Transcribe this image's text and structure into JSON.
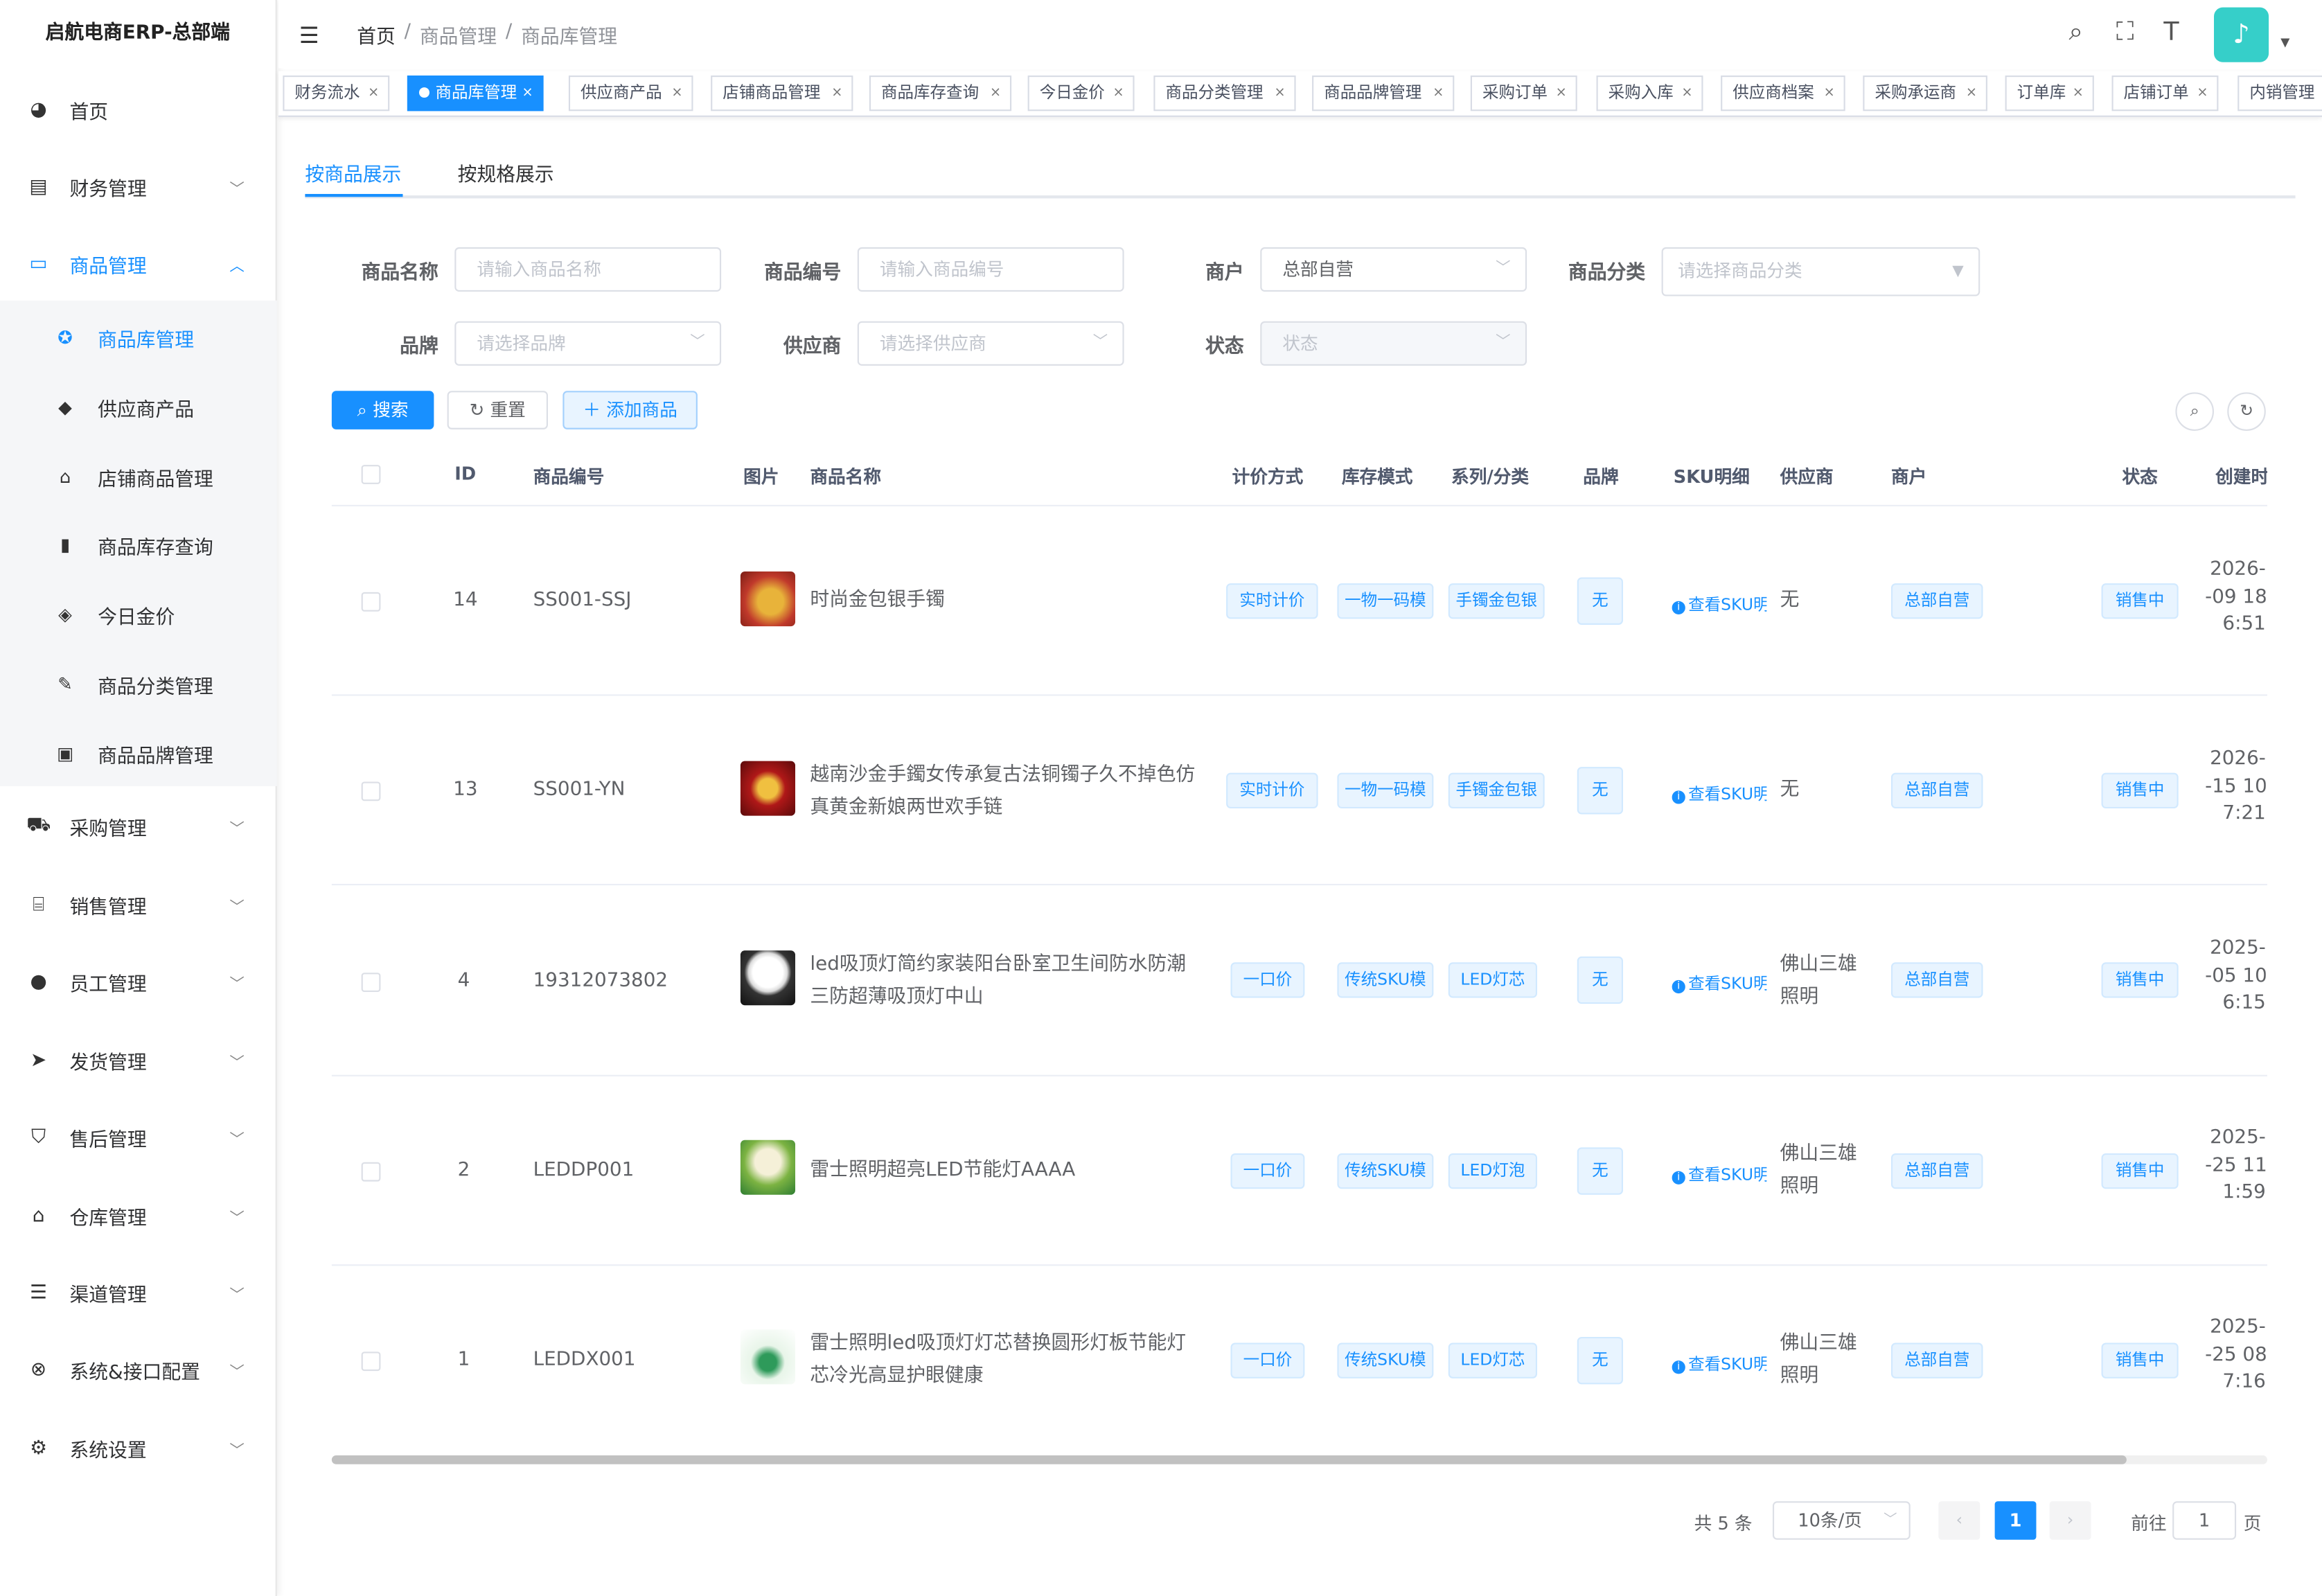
{
  "app_title": "启航电商ERP-总部端",
  "sidebar": {
    "items": [
      {
        "label": "首页",
        "icon": "dashboard-icon"
      },
      {
        "label": "财务管理",
        "icon": "finance-icon"
      },
      {
        "label": "商品管理",
        "icon": "bag-icon"
      },
      {
        "label": "采购管理",
        "icon": "cart-icon"
      },
      {
        "label": "销售管理",
        "icon": "sales-icon"
      },
      {
        "label": "员工管理",
        "icon": "user-icon"
      },
      {
        "label": "发货管理",
        "icon": "send-icon"
      },
      {
        "label": "售后管理",
        "icon": "shield-icon"
      },
      {
        "label": "仓库管理",
        "icon": "warehouse-icon"
      },
      {
        "label": "渠道管理",
        "icon": "channel-icon"
      },
      {
        "label": "系统&接口配置",
        "icon": "api-icon"
      },
      {
        "label": "系统设置",
        "icon": "gear-icon"
      }
    ],
    "sub_items": [
      {
        "label": "商品库管理",
        "icon": "compass-icon"
      },
      {
        "label": "供应商产品",
        "icon": "cube-icon"
      },
      {
        "label": "店铺商品管理",
        "icon": "shop-icon"
      },
      {
        "label": "商品库存查询",
        "icon": "chart-icon"
      },
      {
        "label": "今日金价",
        "icon": "gold-icon"
      },
      {
        "label": "商品分类管理",
        "icon": "edit-icon"
      },
      {
        "label": "商品品牌管理",
        "icon": "brand-icon"
      }
    ]
  },
  "header": {
    "breadcrumb": [
      "首页",
      "商品管理",
      "商品库管理"
    ],
    "separator": "/"
  },
  "tags": [
    "财务流水",
    "商品库管理",
    "供应商产品",
    "店铺商品管理",
    "商品库存查询",
    "今日金价",
    "商品分类管理",
    "商品品牌管理",
    "采购订单",
    "采购入库",
    "供应商档案",
    "采购承运商",
    "订单库",
    "店铺订单",
    "内销管理"
  ],
  "tabs": [
    "按商品展示",
    "按规格展示"
  ],
  "filters": {
    "name_label": "商品名称",
    "name_placeholder": "请输入商品名称",
    "code_label": "商品编号",
    "code_placeholder": "请输入商品编号",
    "merchant_label": "商户",
    "merchant_value": "总部自营",
    "category_label": "商品分类",
    "category_placeholder": "请选择商品分类",
    "brand_label": "品牌",
    "brand_placeholder": "请选择品牌",
    "supplier_label": "供应商",
    "supplier_placeholder": "请选择供应商",
    "status_label": "状态",
    "status_placeholder": "状态"
  },
  "actions": {
    "search": "搜索",
    "reset": "重置",
    "add": "添加商品"
  },
  "table": {
    "columns": [
      "ID",
      "商品编号",
      "图片",
      "商品名称",
      "计价方式",
      "库存模式",
      "系列/分类",
      "品牌",
      "SKU明细",
      "供应商",
      "商户",
      "状态",
      "创建时"
    ],
    "sku_link": "查看SKU明",
    "rows": [
      {
        "id": "14",
        "code": "SS001-SSJ",
        "name": "时尚金包银手镯",
        "pricing": "实时计价",
        "stock_mode": "一物一码模",
        "category": "手镯金包银",
        "brand": "无",
        "supplier": "无",
        "merchant": "总部自营",
        "status": "销售中",
        "created": [
          "2026-",
          "-09 18",
          "6:51"
        ]
      },
      {
        "id": "13",
        "code": "SS001-YN",
        "name": "越南沙金手鐲女传承复古法铜镯子久不掉色仿真黄金新娘两世欢手链",
        "pricing": "实时计价",
        "stock_mode": "一物一码模",
        "category": "手镯金包银",
        "brand": "无",
        "supplier": "无",
        "merchant": "总部自营",
        "status": "销售中",
        "created": [
          "2026-",
          "-15 10",
          "7:21"
        ]
      },
      {
        "id": "4",
        "code": "19312073802",
        "name": "led吸顶灯简约家装阳台卧室卫生间防水防潮三防超薄吸顶灯中山",
        "pricing": "一口价",
        "stock_mode": "传统SKU模",
        "category": "LED灯芯",
        "brand": "无",
        "supplier": "佛山三雄照明",
        "merchant": "总部自营",
        "status": "销售中",
        "created": [
          "2025-",
          "-05 10",
          "6:15"
        ]
      },
      {
        "id": "2",
        "code": "LEDDP001",
        "name": "雷士照明超亮LED节能灯AAAA",
        "pricing": "一口价",
        "stock_mode": "传统SKU模",
        "category": "LED灯泡",
        "brand": "无",
        "supplier": "佛山三雄照明",
        "merchant": "总部自营",
        "status": "销售中",
        "created": [
          "2025-",
          "-25 11",
          "1:59"
        ]
      },
      {
        "id": "1",
        "code": "LEDDX001",
        "name": "雷士照明led吸顶灯灯芯替换圆形灯板节能灯芯冷光高显护眼健康",
        "pricing": "一口价",
        "stock_mode": "传统SKU模",
        "category": "LED灯芯",
        "brand": "无",
        "supplier": "佛山三雄照明",
        "merchant": "总部自营",
        "status": "销售中",
        "created": [
          "2025-",
          "-25 08",
          "7:16"
        ]
      }
    ]
  },
  "pagination": {
    "total": "共 5 条",
    "page_size": "10条/页",
    "current": "1",
    "goto_label": "前往",
    "goto_value": "1",
    "page_suffix": "页"
  },
  "colors": {
    "primary": "#1890ff",
    "tag_bg": "#e8f4ff"
  }
}
